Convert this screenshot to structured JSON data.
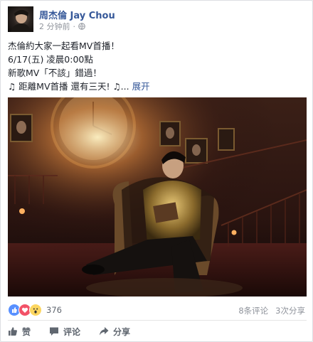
{
  "post": {
    "author": "周杰倫 Jay Chou",
    "time": "2 分钟前",
    "lines": [
      "杰倫約大家一起看MV首播！",
      "6/17(五) 凌晨0:00點",
      "新歌MV「不該」錯過！",
      "♫ 距離MV首播 還有三天! ♫..."
    ],
    "see_more": "展开"
  },
  "photo": {
    "description_icon": "photo-jay-chou-reading-in-clock-room"
  },
  "stats": {
    "reaction_count": "376",
    "comments": "8条评论",
    "shares": "3次分享"
  },
  "actions": {
    "like": "赞",
    "comment": "评论",
    "share": "分享"
  },
  "colors": {
    "link": "#365899",
    "like_reaction": "#5890ff",
    "love_reaction": "#f25268",
    "wow_reaction": "#fcd660"
  }
}
